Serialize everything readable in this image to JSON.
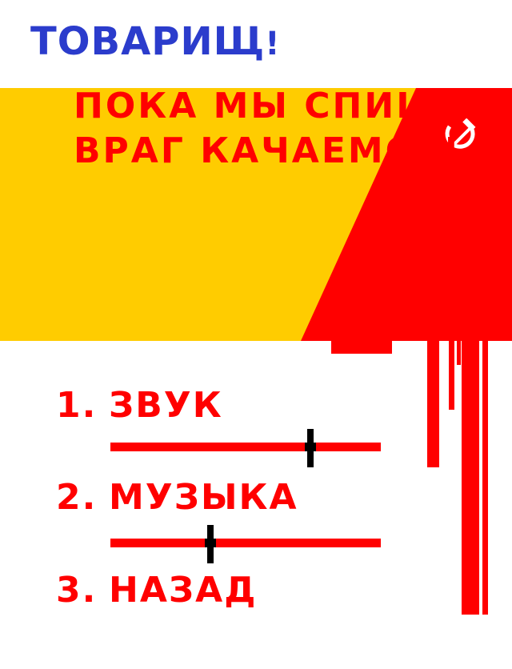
{
  "header": {
    "title": "ТОВАРИЩ",
    "exclaim": "!"
  },
  "banner": {
    "line1": "ПОКА МЫ СПИШЬ",
    "line2": "ВРАГ КАЧАЕМСЯ!",
    "emblem_icon": "hammer-and-sickle-icon",
    "colors": {
      "yellow": "#ffcc00",
      "red": "#ff0000"
    }
  },
  "menu": {
    "items": [
      {
        "num": "1.",
        "label": "ЗВУК"
      },
      {
        "num": "2.",
        "label": "МУЗЫКА"
      },
      {
        "num": "3.",
        "label": "НАЗАД"
      }
    ],
    "sliders": {
      "sound": {
        "value": 0.74
      },
      "music": {
        "value": 0.37
      }
    }
  },
  "colors": {
    "title": "#2b3ccc",
    "menu": "#ff0000",
    "knob": "#000000"
  }
}
